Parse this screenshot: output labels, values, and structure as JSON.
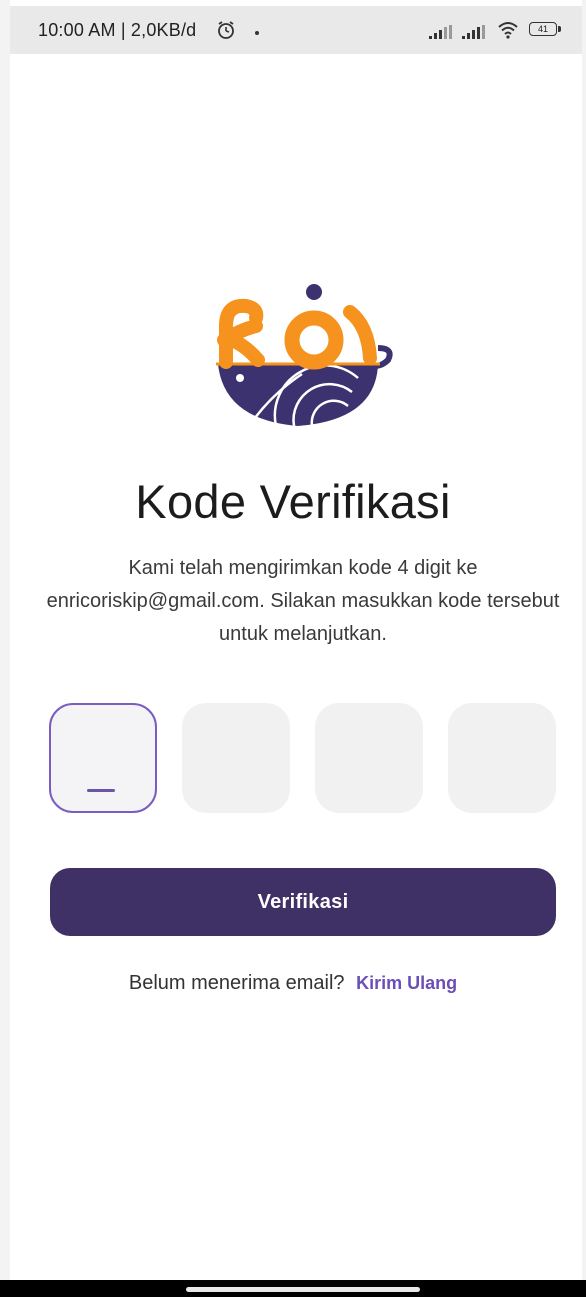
{
  "status_bar": {
    "text": "10:00 AM | 2,0KB/d",
    "battery": "41"
  },
  "screen": {
    "title": "Kode Verifikasi",
    "description": "Kami telah mengirimkan kode 4 digit ke enricoriskip@gmail.com. Silakan masukkan kode tersebut untuk melanjutkan.",
    "otp_digits": [
      "",
      "",
      "",
      ""
    ],
    "verify_button": "Verifikasi",
    "resend_prompt": "Belum menerima email?",
    "resend_link": "Kirim Ulang"
  },
  "logo": {
    "text": "Koi"
  },
  "colors": {
    "primary": "#3f3166",
    "accent": "#7b5cc1",
    "logo_orange": "#f5931e",
    "logo_navy": "#3d3270"
  }
}
